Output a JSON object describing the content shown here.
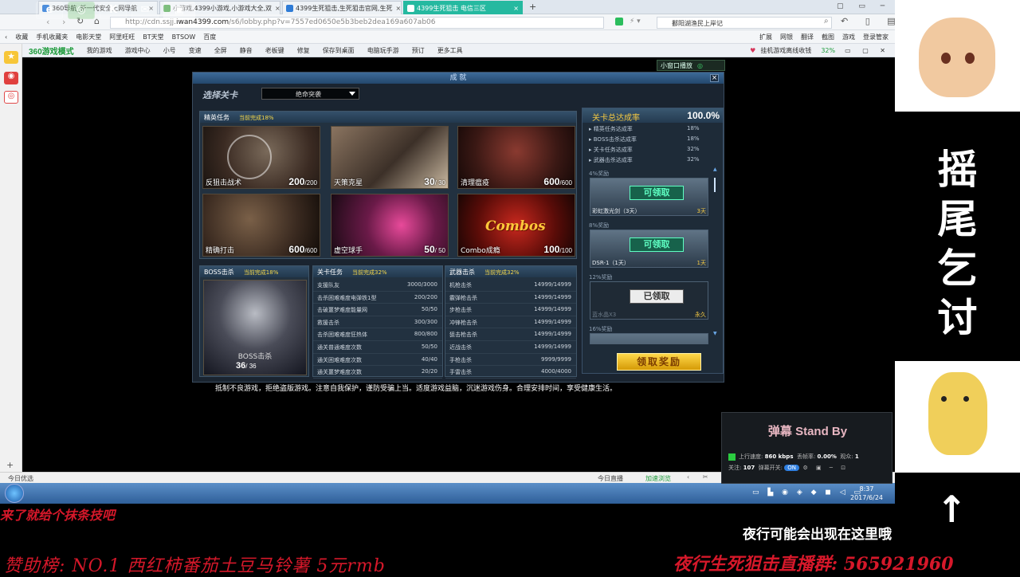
{
  "browser": {
    "tabs": [
      {
        "label": "360导航_新一代安全上网导航",
        "color": "#2e7bd6"
      },
      {
        "label": "小游戏,4399小游戏,小游戏大全,双",
        "color": "#3a9b3a"
      },
      {
        "label": "4399生死狙击,生死狙击官网,生死",
        "color": "#2e7bd6"
      },
      {
        "label": "4399生死狙击 电信三区",
        "color": "#ffffff"
      }
    ],
    "url_prefix": "http://cdn.ssjj.",
    "url_domain": "iwan4399.com",
    "url_suffix": "/s6/lobby.php?v=7557ed0650e5b3beb2dea169a607ab06",
    "search_text": "鄱阳湖渔民上岸记",
    "bookmarks": [
      "收藏",
      "手机收藏夹",
      "电影天堂",
      "阿里旺旺",
      "BT天堂",
      "BTSOW",
      "百度"
    ],
    "right_tools": [
      "扩展",
      "网银",
      "翻译",
      "截图",
      "游戏",
      "登录管家"
    ]
  },
  "gamebar": {
    "brand": "360游戏模式",
    "items": [
      "我的游戏",
      "游戏中心",
      "小号",
      "变速",
      "全屏",
      "静音",
      "老板键",
      "修复",
      "保存到桌面",
      "电脑玩手游",
      "预订",
      "更多工具"
    ],
    "right_text": "挂机游戏离线收钱",
    "right_pct": "32%",
    "mini_window": "小窗口播放"
  },
  "dialog": {
    "title": "成 就",
    "close": "×",
    "select_label": "选择关卡",
    "select_value": "绝命突袭",
    "elite": {
      "title": "精英任务",
      "progress": "当前完成18%",
      "cards": [
        {
          "name": "反狙击战术",
          "value": "200",
          "max": "/200"
        },
        {
          "name": "天策克星",
          "value": "30",
          "max": "/ 30"
        },
        {
          "name": "清理瘟疫",
          "value": "600",
          "max": "/600"
        },
        {
          "name": "精确打击",
          "value": "600",
          "max": "/600"
        },
        {
          "name": "虚空球手",
          "value": "50",
          "max": "/ 50"
        },
        {
          "name": "Combo成瘾",
          "value": "100",
          "max": "/100"
        }
      ],
      "combos_text": "Combos"
    },
    "boss": {
      "title": "BOSS击杀",
      "progress": "当前完成18%",
      "label": "BOSS击杀",
      "value": "36",
      "max": "/ 36"
    },
    "stage": {
      "title": "关卡任务",
      "progress": "当前完成32%",
      "rows": [
        {
          "name": "支援队友",
          "value": "3000/3000"
        },
        {
          "name": "击杀困难难度电弹铁1型",
          "value": "200/200"
        },
        {
          "name": "击破噩梦难度能量网",
          "value": "50/50"
        },
        {
          "name": "救援击杀",
          "value": "300/300"
        },
        {
          "name": "击杀困难难度狂热体",
          "value": "800/800"
        },
        {
          "name": "通关普通难度次数",
          "value": "50/50"
        },
        {
          "name": "通关困难难度次数",
          "value": "40/40"
        },
        {
          "name": "通关噩梦难度次数",
          "value": "20/20"
        }
      ]
    },
    "weapon": {
      "title": "武器击杀",
      "progress": "当前完成32%",
      "rows": [
        {
          "name": "机枪击杀",
          "value": "14999/14999"
        },
        {
          "name": "霰弹枪击杀",
          "value": "14999/14999"
        },
        {
          "name": "步枪击杀",
          "value": "14999/14999"
        },
        {
          "name": "冲锋枪击杀",
          "value": "14999/14999"
        },
        {
          "name": "狙击枪击杀",
          "value": "14999/14999"
        },
        {
          "name": "近战击杀",
          "value": "14999/14999"
        },
        {
          "name": "手枪击杀",
          "value": "9999/9999"
        },
        {
          "name": "手雷击杀",
          "value": "4000/4000"
        }
      ]
    },
    "summary": {
      "title": "关卡总达成率",
      "total": "100.0%",
      "stats": [
        {
          "label": "精英任务达成率",
          "value": "18%"
        },
        {
          "label": "BOSS击杀达成率",
          "value": "18%"
        },
        {
          "label": "关卡任务达成率",
          "value": "32%"
        },
        {
          "label": "武器击杀达成率",
          "value": "32%"
        }
      ],
      "rewards": [
        {
          "pct": "4%奖励",
          "button": "可领取",
          "state": "can",
          "item": "彩虹激光剑（3天）",
          "duration": "3天"
        },
        {
          "pct": "8%奖励",
          "button": "可领取",
          "state": "can",
          "item": "DSR-1（1天）",
          "duration": "1天"
        },
        {
          "pct": "12%奖励",
          "button": "已领取",
          "state": "done",
          "item": "蓝水晶X3",
          "duration": "永久"
        },
        {
          "pct": "16%奖励",
          "button": "",
          "state": "none",
          "item": "",
          "duration": ""
        }
      ],
      "claim_button": "领取奖励"
    }
  },
  "notice": "抵制不良游戏，拒绝盗版游戏。注意自我保护，谨防受骗上当。适度游戏益脑，沉迷游戏伤身。合理安排时间，享受健康生活。",
  "statusbar": {
    "left": "今日优选",
    "live": "今日直播",
    "accel": "加速浏览"
  },
  "taskbar": {
    "time": "8:37",
    "date": "2017/6/24"
  },
  "stream": {
    "vertical_text": "摇尾乞讨",
    "danmaku_title": "弹幕 Stand By",
    "upload_label": "上行速度:",
    "upload_value": "860 kbps",
    "loss_label": "丢帧率:",
    "loss_value": "0.00%",
    "viewers_label": "观众:",
    "viewers_value": "1",
    "follow_label": "关注:",
    "follow_value": "107",
    "switch_label": "弹幕开关:",
    "switch_state": "ON",
    "red_top": "来了就给个抹条技吧",
    "note": "夜行可能会出现在这里哦",
    "sponsor": "赞助榜: NO.1   西红柿番茄土豆马铃薯   5元rmb",
    "channel": "夜行生死狙击直播群: 565921960",
    "arrow": "↑"
  }
}
